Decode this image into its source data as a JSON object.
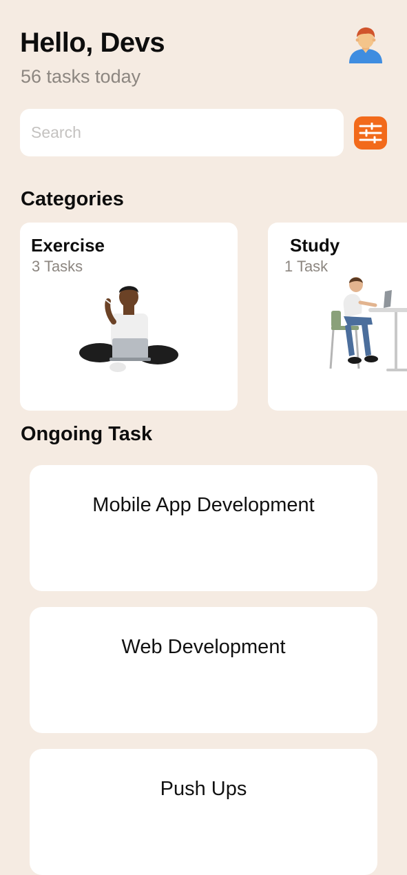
{
  "header": {
    "greeting": "Hello, Devs",
    "subtitle": "56 tasks today",
    "avatar_icon": "person-avatar-icon"
  },
  "search": {
    "placeholder": "Search",
    "value": ""
  },
  "filter": {
    "icon": "sliders-icon",
    "color": "#F26A1B"
  },
  "categories": {
    "title": "Categories",
    "items": [
      {
        "name": "Exercise",
        "count": "3 Tasks"
      },
      {
        "name": "Study",
        "count": "1 Task"
      }
    ]
  },
  "ongoing": {
    "title": "Ongoing Task",
    "items": [
      {
        "name": "Mobile App Development"
      },
      {
        "name": "Web Development"
      },
      {
        "name": "Push Ups"
      }
    ]
  },
  "colors": {
    "background": "#F5EBE2",
    "card": "#FFFFFF",
    "accent": "#F26A1B",
    "muted_text": "#8C8680"
  }
}
